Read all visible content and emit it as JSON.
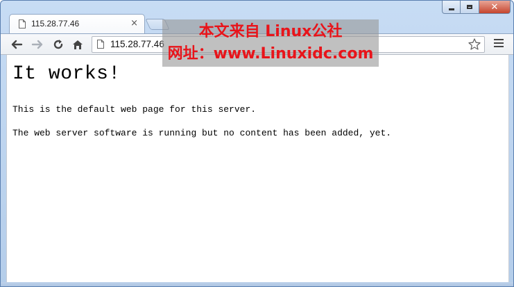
{
  "browser": {
    "tab": {
      "title": "115.28.77.46",
      "close_glyph": "×"
    },
    "controls": {
      "minimize_icon": "minimize-icon",
      "maximize_icon": "maximize-icon",
      "close_glyph": "✕"
    },
    "toolbar": {
      "url": "115.28.77.46",
      "icons": [
        "back-icon",
        "forward-icon",
        "reload-icon",
        "home-icon",
        "star-icon",
        "menu-icon"
      ]
    }
  },
  "page": {
    "heading": "It works!",
    "paragraph1": "This is the default web page for this server.",
    "paragraph2": "The web server software is running but no content has been added, yet."
  },
  "watermark": {
    "line1": "本文来自 Linux公社",
    "line2": "网址：www.Linuxidc.com"
  },
  "colors": {
    "watermark_text": "#e8141a",
    "frame": "#c7dcf4"
  }
}
